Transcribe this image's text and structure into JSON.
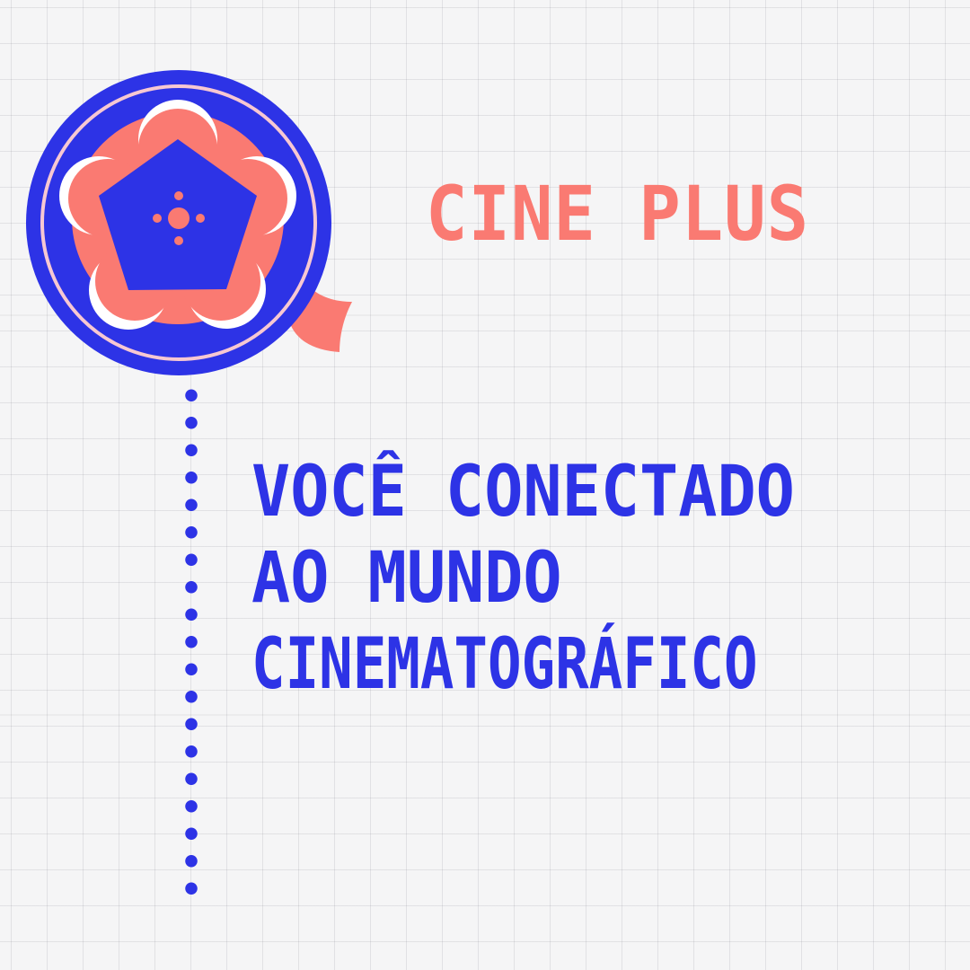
{
  "brand": {
    "title": "CINE PLUS"
  },
  "tagline": {
    "lines": [
      "VOCÊ CONECTADO",
      "AO MUNDO",
      "CINEMATOGRÁFICO"
    ]
  },
  "colors": {
    "primary_blue": "#2d33e6",
    "coral": "#fa7a72",
    "light_pink_ring": "#f7c8d2",
    "background": "#f5f5f6"
  },
  "icons": {
    "reel": "film-reel-icon",
    "connector": "dotted-line"
  }
}
